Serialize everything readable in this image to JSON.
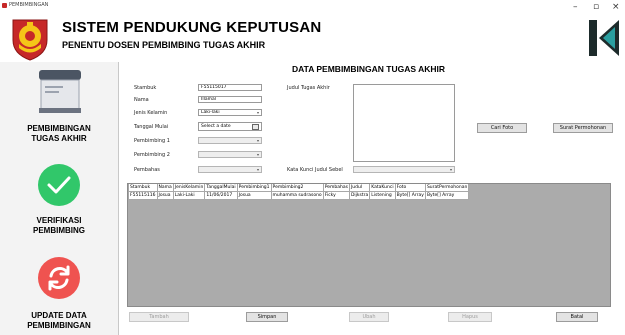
{
  "window": {
    "title": "PEMBIMBINGAN",
    "minimize": "–",
    "maximize": "▫",
    "close": "×"
  },
  "header": {
    "title": "SISTEM PENDUKUNG KEPUTUSAN",
    "subtitle": "PENENTU DOSEN PEMBIMBING TUGAS AKHIR"
  },
  "sidebar": {
    "items": [
      {
        "label_line1": "PEMBIMBINGAN",
        "label_line2": "TUGAS AKHIR"
      },
      {
        "label_line1": "VERIFIKASI",
        "label_line2": "PEMBIMBING"
      },
      {
        "label_line1": "UPDATE DATA",
        "label_line2": "PEMBIMBINGAN"
      }
    ]
  },
  "form": {
    "title": "DATA PEMBIMBINGAN TUGAS AKHIR",
    "labels": {
      "stambuk": "Stambuk",
      "nama": "Nama",
      "jenis_kelamin": "Jenis Kelamin",
      "tanggal_mulai": "Tanggal Mulai",
      "pembimbing1": "Pembimbing 1",
      "pembimbing2": "Pembimbing 2",
      "pembahas": "Pembahas",
      "judul": "Judul Tugas Akhir",
      "kata_kunci": "Kata Kunci Judul Sebel"
    },
    "values": {
      "stambuk": "F55115017",
      "nama": "Illamal",
      "jenis_kelamin": "Laki-laki",
      "tanggal_mulai": "Select a date",
      "pembimbing1": "",
      "pembimbing2": "",
      "pembahas": "",
      "kata_kunci": ""
    },
    "buttons": {
      "cari_foto": "Cari Foto",
      "surat_permohonan": "Surat Permohonan"
    }
  },
  "table": {
    "columns": [
      "Stambuk",
      "Nama",
      "JenisKelamin",
      "TanggalMulai",
      "Pembimbing1",
      "Pembimbing2",
      "Pembahas",
      "Judul",
      "KataKunci",
      "Foto",
      "SuratPermohonan"
    ],
    "rows": [
      [
        "F55115116",
        "Josua",
        "Laki-Laki",
        "11/06/2017",
        "Josua",
        "muhamma sudrasono",
        "Ficky",
        "Dijkstra",
        "Listening",
        "Byte[] Array",
        "Byte[] Array"
      ]
    ]
  },
  "footer": {
    "tambah": "Tambah",
    "simpan": "Simpan",
    "ubah": "Ubah",
    "hapus": "Hapus",
    "batal": "Batal"
  },
  "colors": {
    "verify_icon": "#31c76a",
    "update_icon": "#ef5350",
    "logo_dark": "#1d2b2b",
    "logo_teal": "#2a9fa0"
  }
}
